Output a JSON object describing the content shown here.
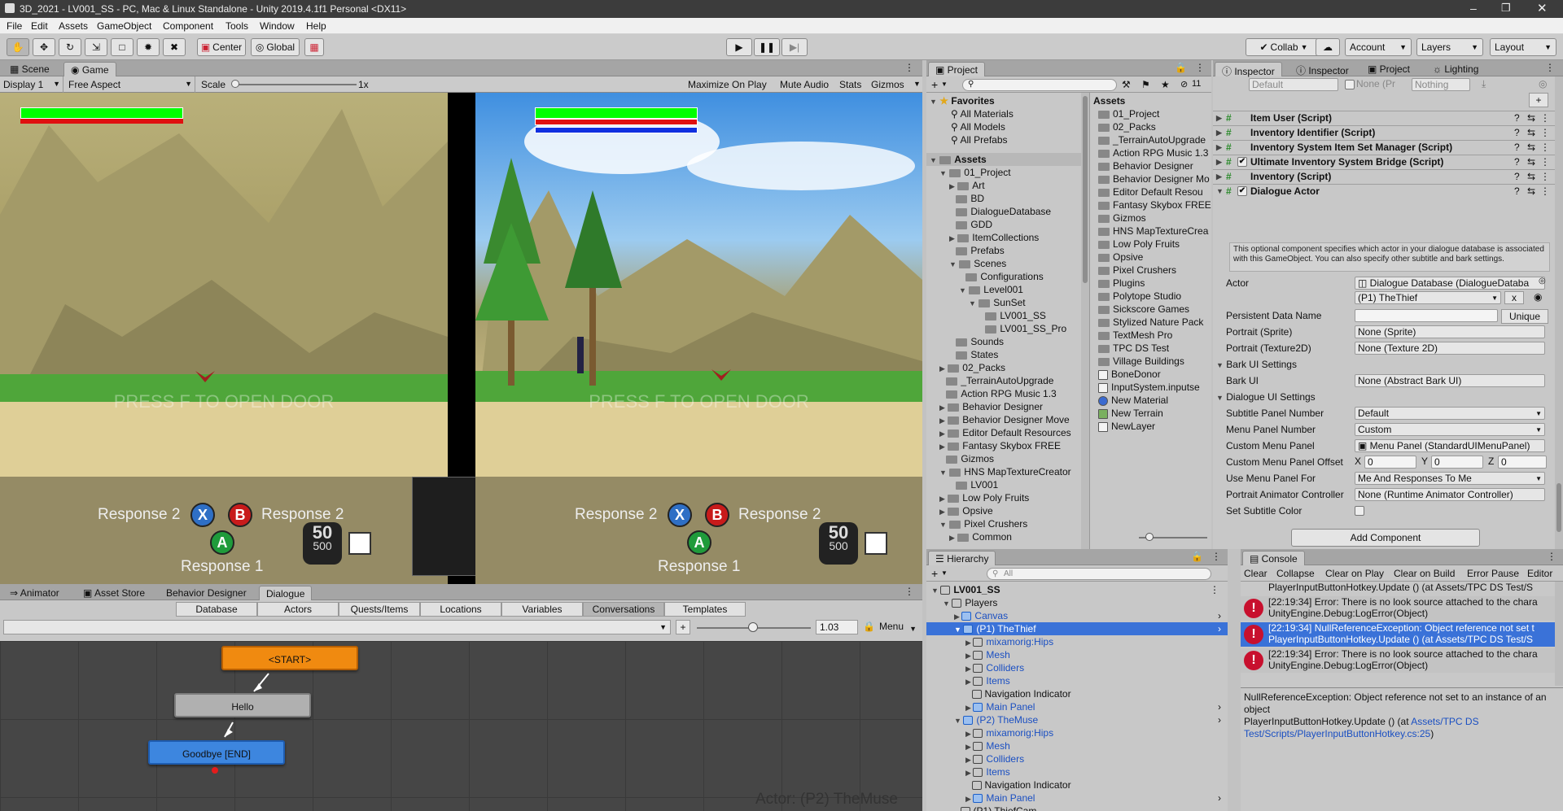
{
  "window": {
    "title": "3D_2021 - LV001_SS - PC, Mac & Linux Standalone - Unity 2019.4.1f1 Personal <DX11>"
  },
  "menu": [
    "File",
    "Edit",
    "Assets",
    "GameObject",
    "Component",
    "Tools",
    "Window",
    "Help"
  ],
  "toolbar": {
    "center_label": "Center",
    "global_label": "Global",
    "collab_label": "Collab",
    "account_label": "Account",
    "layers_label": "Layers",
    "layout_label": "Layout"
  },
  "scene_tabs": {
    "scene": "Scene",
    "game": "Game"
  },
  "game_bar": {
    "display": "Display 1",
    "aspect": "Free Aspect",
    "scale_label": "Scale",
    "scale_value": "1x",
    "maximize": "Maximize On Play",
    "mute": "Mute Audio",
    "stats": "Stats",
    "gizmos": "Gizmos"
  },
  "game_view": {
    "left": {
      "prompt": "PRESS F TO OPEN DOOR",
      "resp_left": "Response 2",
      "resp_right": "Response 2",
      "resp_bottom": "Response 1",
      "btn_x": "X",
      "btn_b": "B",
      "btn_a": "A",
      "ammo_top": "50",
      "ammo_bottom": "500",
      "health_fill": 1.0
    },
    "right": {
      "prompt": "PRESS F TO OPEN DOOR",
      "resp_left": "Response 2",
      "resp_right": "Response 2",
      "resp_bottom": "Response 1",
      "btn_x": "X",
      "btn_b": "B",
      "btn_a": "A",
      "ammo_top": "50",
      "ammo_bottom": "500",
      "health_fill": 1.0
    }
  },
  "bottom_tabs": [
    "Animator",
    "Asset Store",
    "Behavior Designer",
    "Dialogue"
  ],
  "dialogue": {
    "tabs": [
      "Database",
      "Actors",
      "Quests/Items",
      "Locations",
      "Variables",
      "Conversations",
      "Templates"
    ],
    "zoom": "1.03",
    "menu_label": "Menu",
    "nodes": {
      "start": "<START>",
      "hello": "Hello",
      "goodbye": "Goodbye [END]"
    },
    "actor_label": "Actor: (P2) TheMuse"
  },
  "project": {
    "tab": "Project",
    "badge": "11",
    "favorites_label": "Favorites",
    "favorites": [
      "All Materials",
      "All Models",
      "All Prefabs"
    ],
    "assets_label": "Assets",
    "tree": [
      {
        "depth": 1,
        "label": "01_Project",
        "open": true
      },
      {
        "depth": 2,
        "label": "Art",
        "open": false
      },
      {
        "depth": 2,
        "label": "BD",
        "open": null
      },
      {
        "depth": 2,
        "label": "DialogueDatabase",
        "open": null
      },
      {
        "depth": 2,
        "label": "GDD",
        "open": null
      },
      {
        "depth": 2,
        "label": "ItemCollections",
        "open": false
      },
      {
        "depth": 2,
        "label": "Prefabs",
        "open": null
      },
      {
        "depth": 2,
        "label": "Scenes",
        "open": true
      },
      {
        "depth": 3,
        "label": "Configurations",
        "open": null
      },
      {
        "depth": 3,
        "label": "Level001",
        "open": true
      },
      {
        "depth": 4,
        "label": "SunSet",
        "open": true
      },
      {
        "depth": 5,
        "label": "LV001_SS",
        "open": null
      },
      {
        "depth": 5,
        "label": "LV001_SS_Pro",
        "open": null
      },
      {
        "depth": 2,
        "label": "Sounds",
        "open": null
      },
      {
        "depth": 2,
        "label": "States",
        "open": null
      },
      {
        "depth": 1,
        "label": "02_Packs",
        "open": false
      },
      {
        "depth": 1,
        "label": "_TerrainAutoUpgrade",
        "open": null
      },
      {
        "depth": 1,
        "label": "Action RPG Music 1.3",
        "open": null
      },
      {
        "depth": 1,
        "label": "Behavior Designer",
        "open": false
      },
      {
        "depth": 1,
        "label": "Behavior Designer Move",
        "open": false
      },
      {
        "depth": 1,
        "label": "Editor Default Resources",
        "open": false
      },
      {
        "depth": 1,
        "label": "Fantasy Skybox FREE",
        "open": false
      },
      {
        "depth": 1,
        "label": "Gizmos",
        "open": null
      },
      {
        "depth": 1,
        "label": "HNS MapTextureCreator",
        "open": true
      },
      {
        "depth": 2,
        "label": "LV001",
        "open": null
      },
      {
        "depth": 1,
        "label": "Low Poly Fruits",
        "open": false
      },
      {
        "depth": 1,
        "label": "Opsive",
        "open": false
      },
      {
        "depth": 1,
        "label": "Pixel Crushers",
        "open": true
      },
      {
        "depth": 2,
        "label": "Common",
        "open": false
      }
    ],
    "assets_header": "Assets",
    "asset_list": [
      {
        "label": "01_Project",
        "kind": "folder"
      },
      {
        "label": "02_Packs",
        "kind": "folder"
      },
      {
        "label": "_TerrainAutoUpgrade",
        "kind": "folder"
      },
      {
        "label": "Action RPG Music 1.3",
        "kind": "folder"
      },
      {
        "label": "Behavior Designer",
        "kind": "folder"
      },
      {
        "label": "Behavior Designer Mo",
        "kind": "folder"
      },
      {
        "label": "Editor Default Resou",
        "kind": "folder"
      },
      {
        "label": "Fantasy Skybox FREE",
        "kind": "folder"
      },
      {
        "label": "Gizmos",
        "kind": "folder"
      },
      {
        "label": "HNS MapTextureCrea",
        "kind": "folder"
      },
      {
        "label": "Low Poly Fruits",
        "kind": "folder"
      },
      {
        "label": "Opsive",
        "kind": "folder"
      },
      {
        "label": "Pixel Crushers",
        "kind": "folder"
      },
      {
        "label": "Plugins",
        "kind": "folder"
      },
      {
        "label": "Polytope Studio",
        "kind": "folder"
      },
      {
        "label": "Sickscore Games",
        "kind": "folder"
      },
      {
        "label": "Stylized Nature Pack",
        "kind": "folder"
      },
      {
        "label": "TextMesh Pro",
        "kind": "folder"
      },
      {
        "label": "TPC DS Test",
        "kind": "folder"
      },
      {
        "label": "Village Buildings",
        "kind": "folder"
      },
      {
        "label": "BoneDonor",
        "kind": "script"
      },
      {
        "label": "InputSystem.inputse",
        "kind": "input"
      },
      {
        "label": "New Material",
        "kind": "material"
      },
      {
        "label": "New Terrain",
        "kind": "terrain"
      },
      {
        "label": "NewLayer",
        "kind": "file"
      }
    ]
  },
  "inspector": {
    "tabs": [
      "Inspector",
      "Inspector",
      "Project",
      "Lighting"
    ],
    "top_values": {
      "tag": "Default",
      "none": "None (Pr",
      "nothing": "Nothing"
    },
    "components": [
      {
        "label": "Item User (Script)",
        "checkbox": false
      },
      {
        "label": "Inventory Identifier (Script)",
        "checkbox": false
      },
      {
        "label": "Inventory System Item Set Manager (Script)",
        "checkbox": false
      },
      {
        "label": "Ultimate Inventory System Bridge (Script)",
        "checkbox": true
      },
      {
        "label": "Inventory (Script)",
        "checkbox": false
      },
      {
        "label": "Dialogue Actor",
        "checkbox": true
      }
    ],
    "help": "This optional component specifies which actor in your dialogue database is associated with this GameObject. You can also specify other subtitle and bark settings.",
    "fields": {
      "actor_label": "Actor",
      "actor_db": "Dialogue Database (DialogueDataba",
      "actor_value": "(P1) TheThief",
      "actor_x": "x",
      "persistent_label": "Persistent Data Name",
      "unique": "Unique",
      "portrait_sprite_label": "Portrait (Sprite)",
      "portrait_sprite": "None (Sprite)",
      "portrait_tex_label": "Portrait (Texture2D)",
      "portrait_tex": "None (Texture 2D)",
      "bark_settings": "Bark UI Settings",
      "bark_ui_label": "Bark UI",
      "bark_ui": "None (Abstract Bark UI)",
      "dialogue_settings": "Dialogue UI Settings",
      "subtitle_panel_label": "Subtitle Panel Number",
      "subtitle_panel": "Default",
      "menu_panel_label": "Menu Panel Number",
      "menu_panel": "Custom",
      "custom_menu_label": "Custom Menu Panel",
      "custom_menu": "Menu Panel (StandardUIMenuPanel)",
      "offset_label": "Custom Menu Panel Offset",
      "x_label": "X",
      "y_label": "Y",
      "z_label": "Z",
      "x": "0",
      "y": "0",
      "z": "0",
      "use_menu_label": "Use Menu Panel For",
      "use_menu": "Me And Responses To Me",
      "portrait_anim_label": "Portrait Animator Controller",
      "portrait_anim": "None (Runtime Animator Controller)",
      "subtitle_color_label": "Set Subtitle Color"
    },
    "add_component": "Add Component"
  },
  "hierarchy": {
    "tab": "Hierarchy",
    "search": "All",
    "rows": [
      {
        "depth": 0,
        "label": "LV001_SS",
        "kind": "scene",
        "sel": false,
        "blue": false,
        "arrow": "open",
        "bold": true
      },
      {
        "depth": 1,
        "label": "Players",
        "kind": "obj",
        "sel": false,
        "blue": false,
        "arrow": "open"
      },
      {
        "depth": 2,
        "label": "Canvas",
        "kind": "blue",
        "sel": false,
        "blue": true,
        "arrow": "closed"
      },
      {
        "depth": 2,
        "label": "(P1) TheThief",
        "kind": "blue",
        "sel": true,
        "blue": true,
        "arrow": "open"
      },
      {
        "depth": 3,
        "label": "mixamorig:Hips",
        "kind": "obj",
        "sel": false,
        "blue": true,
        "arrow": "closed"
      },
      {
        "depth": 3,
        "label": "Mesh",
        "kind": "obj",
        "sel": false,
        "blue": true,
        "arrow": "closed"
      },
      {
        "depth": 3,
        "label": "Colliders",
        "kind": "obj",
        "sel": false,
        "blue": true,
        "arrow": "closed"
      },
      {
        "depth": 3,
        "label": "Items",
        "kind": "obj",
        "sel": false,
        "blue": true,
        "arrow": "closed"
      },
      {
        "depth": 3,
        "label": "Navigation Indicator",
        "kind": "obj",
        "sel": false,
        "blue": false,
        "arrow": null
      },
      {
        "depth": 3,
        "label": "Main Panel",
        "kind": "blue",
        "sel": false,
        "blue": true,
        "arrow": "closed"
      },
      {
        "depth": 2,
        "label": "(P2) TheMuse",
        "kind": "blue",
        "sel": false,
        "blue": true,
        "arrow": "open"
      },
      {
        "depth": 3,
        "label": "mixamorig:Hips",
        "kind": "obj",
        "sel": false,
        "blue": true,
        "arrow": "closed"
      },
      {
        "depth": 3,
        "label": "Mesh",
        "kind": "obj",
        "sel": false,
        "blue": true,
        "arrow": "closed"
      },
      {
        "depth": 3,
        "label": "Colliders",
        "kind": "obj",
        "sel": false,
        "blue": true,
        "arrow": "closed"
      },
      {
        "depth": 3,
        "label": "Items",
        "kind": "obj",
        "sel": false,
        "blue": true,
        "arrow": "closed"
      },
      {
        "depth": 3,
        "label": "Navigation Indicator",
        "kind": "obj",
        "sel": false,
        "blue": false,
        "arrow": null
      },
      {
        "depth": 3,
        "label": "Main Panel",
        "kind": "blue",
        "sel": false,
        "blue": true,
        "arrow": "closed"
      },
      {
        "depth": 2,
        "label": "(P1) ThiefCam",
        "kind": "obj",
        "sel": false,
        "blue": false,
        "arrow": null
      }
    ]
  },
  "console": {
    "tab": "Console",
    "buttons": [
      "Clear",
      "Collapse",
      "Clear on Play",
      "Clear on Build",
      "Error Pause",
      "Editor"
    ],
    "entries": [
      {
        "line1": "PlayerInputButtonHotkey.Update () (at Assets/TPC DS Test/S",
        "line2": "",
        "sel": false,
        "partial": true
      },
      {
        "line1": "[22:19:34] Error: There is no look source attached to the chara",
        "line2": "UnityEngine.Debug:LogError(Object)",
        "sel": false
      },
      {
        "line1": "[22:19:34] NullReferenceException: Object reference not set t",
        "line2": "PlayerInputButtonHotkey.Update () (at Assets/TPC DS Test/S",
        "sel": true
      },
      {
        "line1": "[22:19:34] Error: There is no look source attached to the chara",
        "line2": "UnityEngine.Debug:LogError(Object)",
        "sel": false
      }
    ],
    "detail": "NullReferenceException: Object reference not set to an instance of an object",
    "detail2": "PlayerInputButtonHotkey.Update () (at ",
    "detail_link": "Assets/TPC DS Test/Scripts/PlayerInputButtonHotkey.cs:25",
    "detail3": ")"
  }
}
